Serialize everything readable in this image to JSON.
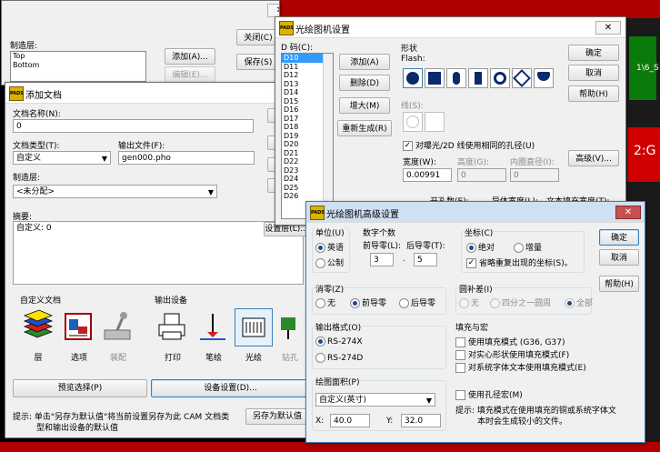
{
  "background": {
    "right_text_1": "1\\6_S",
    "right_text_2": "2:G"
  },
  "cam_window": {
    "close_x": "✕",
    "layers_label": "制造层:",
    "layers": [
      "Top",
      "Bottom"
    ],
    "add_label": "添加(A)...",
    "edit_label": "编辑(E)...",
    "close_label": "关闭(C)",
    "save_label": "保存(S)"
  },
  "add_doc": {
    "title": "添加文档",
    "name_label": "文档名称(N):",
    "name_value": "0",
    "type_label": "文档类型(T):",
    "type_value": "自定义",
    "output_label": "输出文件(F):",
    "output_value": "gen000.pho",
    "layer_label": "制造层:",
    "layer_value": "<未分配>",
    "summary_label": "摘要:",
    "summary_value": "自定义: 0",
    "custom_docs_label": "自定义文档",
    "output_devices_label": "输出设备",
    "custom_docs": [
      {
        "label": "层",
        "enabled": true
      },
      {
        "label": "选项",
        "enabled": true
      },
      {
        "label": "装配",
        "enabled": false
      }
    ],
    "devices": [
      {
        "label": "打印"
      },
      {
        "label": "笔绘"
      },
      {
        "label": "光绘"
      },
      {
        "label": "钻孔"
      }
    ],
    "preview_label": "预览选择(P)",
    "device_settings_label": "设备设置(D)...",
    "hint_text_1": "提示: 单击\"另存为默认值\"将当前设置另存为此 CAM 文档类",
    "hint_text_2": "型和输出设备的默认值",
    "save_default_label": "另存为默认值",
    "side_label": "设置层(L)..."
  },
  "photo_setup": {
    "title": "光绘图机设置",
    "close_x": "✕",
    "dcode_label": "D 码(C):",
    "dcodes": [
      "D10",
      "D11",
      "D12",
      "D13",
      "D14",
      "D15",
      "D16",
      "D17",
      "D18",
      "D19",
      "D20",
      "D21",
      "D22",
      "D23",
      "D24",
      "D25",
      "D26"
    ],
    "selected_dcode": "D10",
    "add_label": "添加(A)",
    "delete_label": "删除(D)",
    "enlarge_label": "增大(M)",
    "regen_label": "重新生成(R)",
    "shape_label": "形状",
    "flash_label": "Flash:",
    "line_label": "线(S):",
    "same_aperture_label": "对曝光/2D 线使用相同的孔径(U)",
    "same_aperture_checked": true,
    "width_label": "宽度(W):",
    "width_value": "0.00991",
    "height_label": "高度(G):",
    "height_value": "0",
    "inner_label": "内圈直径(I):",
    "inner_value": "0",
    "ok_label": "确定",
    "cancel_label": "取消",
    "help_label": "帮助(H)",
    "advanced_label": "高级(V)...",
    "cut1": "开孔数(E):",
    "cut2": "导体宽度(L):",
    "cut3": "文本填充宽度(T):"
  },
  "advanced": {
    "title": "光绘图机高级设置",
    "units_label": "单位(U)",
    "units": [
      {
        "label": "英语",
        "on": true
      },
      {
        "label": "公制",
        "on": false
      }
    ],
    "digits_label": "数字个数",
    "leading_label": "前导零(L):",
    "trailing_label": "后导零(T):",
    "leading_value": "3",
    "sep": ".",
    "trailing_value": "5",
    "coords_label": "坐标(C)",
    "coords": [
      {
        "label": "绝对",
        "on": true
      },
      {
        "label": "增量",
        "on": false
      }
    ],
    "omit_label": "省略重复出现的坐标(S)。",
    "omit_checked": true,
    "zero_supp_label": "消零(Z)",
    "zero_supp": [
      {
        "label": "无",
        "on": false
      },
      {
        "label": "前导零",
        "on": true
      },
      {
        "label": "后导零",
        "on": false
      }
    ],
    "arc_label": "圆补差(I)",
    "arc": [
      {
        "label": "无",
        "on": false
      },
      {
        "label": "四分之一圆周",
        "on": false
      },
      {
        "label": "全部",
        "on": true
      }
    ],
    "output_format_label": "输出格式(O)",
    "output_formats": [
      {
        "label": "RS-274X",
        "on": true
      },
      {
        "label": "RS-274D",
        "on": false
      }
    ],
    "fill_label": "填充与宏",
    "fill_options": [
      "使用填充模式 (G36, G37)",
      "对实心形状使用填充模式(F)",
      "对系统字体文本使用填充模式(E)"
    ],
    "plot_area_label": "绘图面积(P)",
    "plot_area_value": "自定义(英寸)",
    "x_label": "X:",
    "x_value": "40.0",
    "y_label": "Y:",
    "y_value": "32.0",
    "aperture_macro_label": "使用孔径宏(M)",
    "hint_1": "提示: 填充模式在使用填充的铜或系统字体文",
    "hint_2": "本时会生成较小的文件。",
    "ok_label": "确定",
    "cancel_label": "取消",
    "help_label": "帮助(H)",
    "close_x": "✕"
  }
}
